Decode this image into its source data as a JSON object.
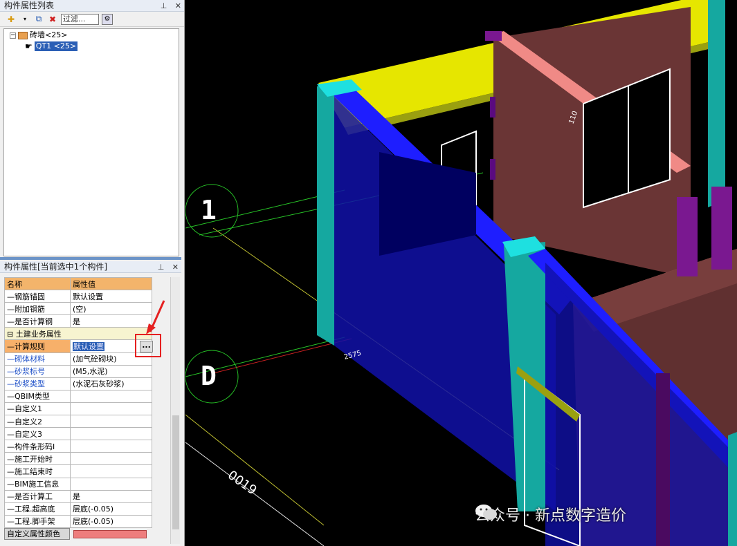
{
  "tree_panel": {
    "title": "构件属性列表",
    "filter_placeholder": "过滤...",
    "root": "砖墙<25>",
    "child": "QT1 <25>"
  },
  "props_panel": {
    "title": "构件属性[当前选中1个构件]",
    "headers": {
      "name": "名称",
      "value": "属性值"
    },
    "rows": [
      {
        "name": "钢筋锚固",
        "value": "默认设置"
      },
      {
        "name": "附加钢筋",
        "value": "(空)"
      },
      {
        "name": "是否计算钢",
        "value": "是"
      },
      {
        "name": "土建业务属性",
        "value": ""
      },
      {
        "name": "计算规则",
        "value": "默认设置"
      },
      {
        "name": "砌体材料",
        "value": "(加气砼砌块)"
      },
      {
        "name": "砂浆标号",
        "value": "(M5,水泥)"
      },
      {
        "name": "砂浆类型",
        "value": "(水泥石灰砂浆)"
      },
      {
        "name": "QBIM类型",
        "value": ""
      },
      {
        "name": "自定义1",
        "value": ""
      },
      {
        "name": "自定义2",
        "value": ""
      },
      {
        "name": "自定义3",
        "value": ""
      },
      {
        "name": "构件条形码I",
        "value": ""
      },
      {
        "name": "施工开始时",
        "value": ""
      },
      {
        "name": "施工结束时",
        "value": ""
      },
      {
        "name": "BIM施工信息",
        "value": ""
      },
      {
        "name": "是否计算工",
        "value": "是"
      },
      {
        "name": "工程.超高底",
        "value": "层底(-0.05)"
      },
      {
        "name": "工程.脚手架",
        "value": "层底(-0.05)"
      }
    ],
    "ellipsis": "...",
    "custom_color_label": "自定义属性颜色"
  },
  "view": {
    "axis_1": "1",
    "axis_d": "D",
    "watermark": "公众号 · 新点数字造价"
  },
  "colors": {
    "wall_blue": "#1010d8",
    "wall_brown": "#6a3535",
    "beam_yellow": "#e6e600",
    "beam_pink": "#f08a86",
    "column_cyan": "#15a8a0"
  }
}
